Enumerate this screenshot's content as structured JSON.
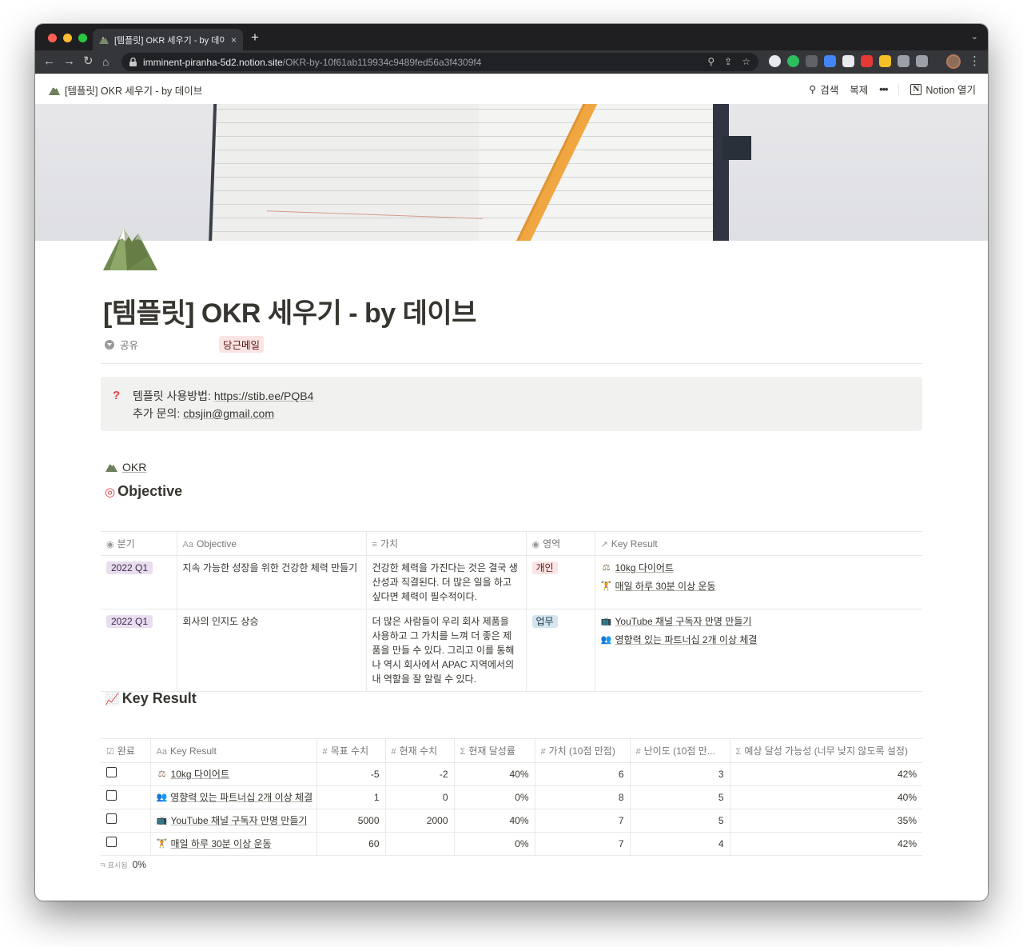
{
  "browser": {
    "tab_title": "[템플릿] OKR 세우기 - by 데이브",
    "tab_close": "×",
    "new_tab": "+",
    "url_host": "imminent-piranha-5d2.notion.site",
    "url_path": "/OKR-by-10f61ab119934c9489fed56a3f4309f4",
    "colors": {
      "close": "#ff5f57",
      "minimize": "#febc2e",
      "maximize": "#28c840"
    }
  },
  "notion_top": {
    "breadcrumb": "[템플릿] OKR 세우기 - by 데이브",
    "search": "검색",
    "duplicate": "복제",
    "more": "•••",
    "open_notion": "Notion 열기",
    "notion_logo": "N"
  },
  "page": {
    "icon": "mountain-icon",
    "title": "[템플릿] OKR 세우기 - by 데이브",
    "property_name": "공유",
    "property_value": "당근메일"
  },
  "callout": {
    "icon": "?",
    "line1_label": "템플릿 사용방법: ",
    "line1_link": "https://stib.ee/PQB4",
    "line2_label": "추가 문의: ",
    "line2_link": "cbsjin@gmail.com"
  },
  "okr_link": "OKR",
  "objective": {
    "heading": "Objective",
    "columns": [
      "분기",
      "Objective",
      "가치",
      "영역",
      "Key Result"
    ],
    "rows": [
      {
        "quarter": "2022 Q1",
        "objective": "지속 가능한 성장을 위한 건강한 체력 만들기",
        "value": "건강한 체력을 가진다는 것은 결국 생산성과 직결된다. 더 많은 일을 하고 싶다면 체력이 필수적이다.",
        "area": "개인",
        "key_results": [
          "10kg 다이어트",
          "매일 하루 30분 이상 운동"
        ]
      },
      {
        "quarter": "2022 Q1",
        "objective": "회사의 인지도 상승",
        "value": "더 많은 사람들이 우리 회사 제품을 사용하고 그 가치를 느껴 더 좋은 제품을 만들 수 있다. 그리고 이를 통해 나 역시 회사에서 APAC 지역에서의 내 역할을 잘 알릴 수 있다.",
        "area": "업무",
        "key_results": [
          "YouTube 채널 구독자 만명 만들기",
          "영향력 있는 파트너십 2개 이상 체결"
        ]
      }
    ]
  },
  "key_result": {
    "heading": "Key Result",
    "columns": [
      "완료",
      "Key Result",
      "목표 수치",
      "현재 수치",
      "현재 달성률",
      "가치 (10점 만점)",
      "난이도 (10점 만...",
      "예상 달성 가능성 (너무 낮지 않도록 설정)"
    ],
    "rows": [
      {
        "done": false,
        "name": "10kg 다이어트",
        "target": "-5",
        "current": "-2",
        "rate": "40%",
        "value": "6",
        "difficulty": "3",
        "likelihood": "42%"
      },
      {
        "done": false,
        "name": "영향력 있는 파트너십 2개 이상 체결",
        "target": "1",
        "current": "0",
        "rate": "0%",
        "value": "8",
        "difficulty": "5",
        "likelihood": "40%"
      },
      {
        "done": false,
        "name": "YouTube 채널 구독자 만명 만들기",
        "target": "5000",
        "current": "2000",
        "rate": "40%",
        "value": "7",
        "difficulty": "5",
        "likelihood": "35%"
      },
      {
        "done": false,
        "name": "매일 하루 30분 이상 운동",
        "target": "60",
        "current": "",
        "rate": "0%",
        "value": "7",
        "difficulty": "4",
        "likelihood": "42%"
      }
    ],
    "footer_label": "ㅋ 표시됨",
    "footer_value": "0%"
  }
}
